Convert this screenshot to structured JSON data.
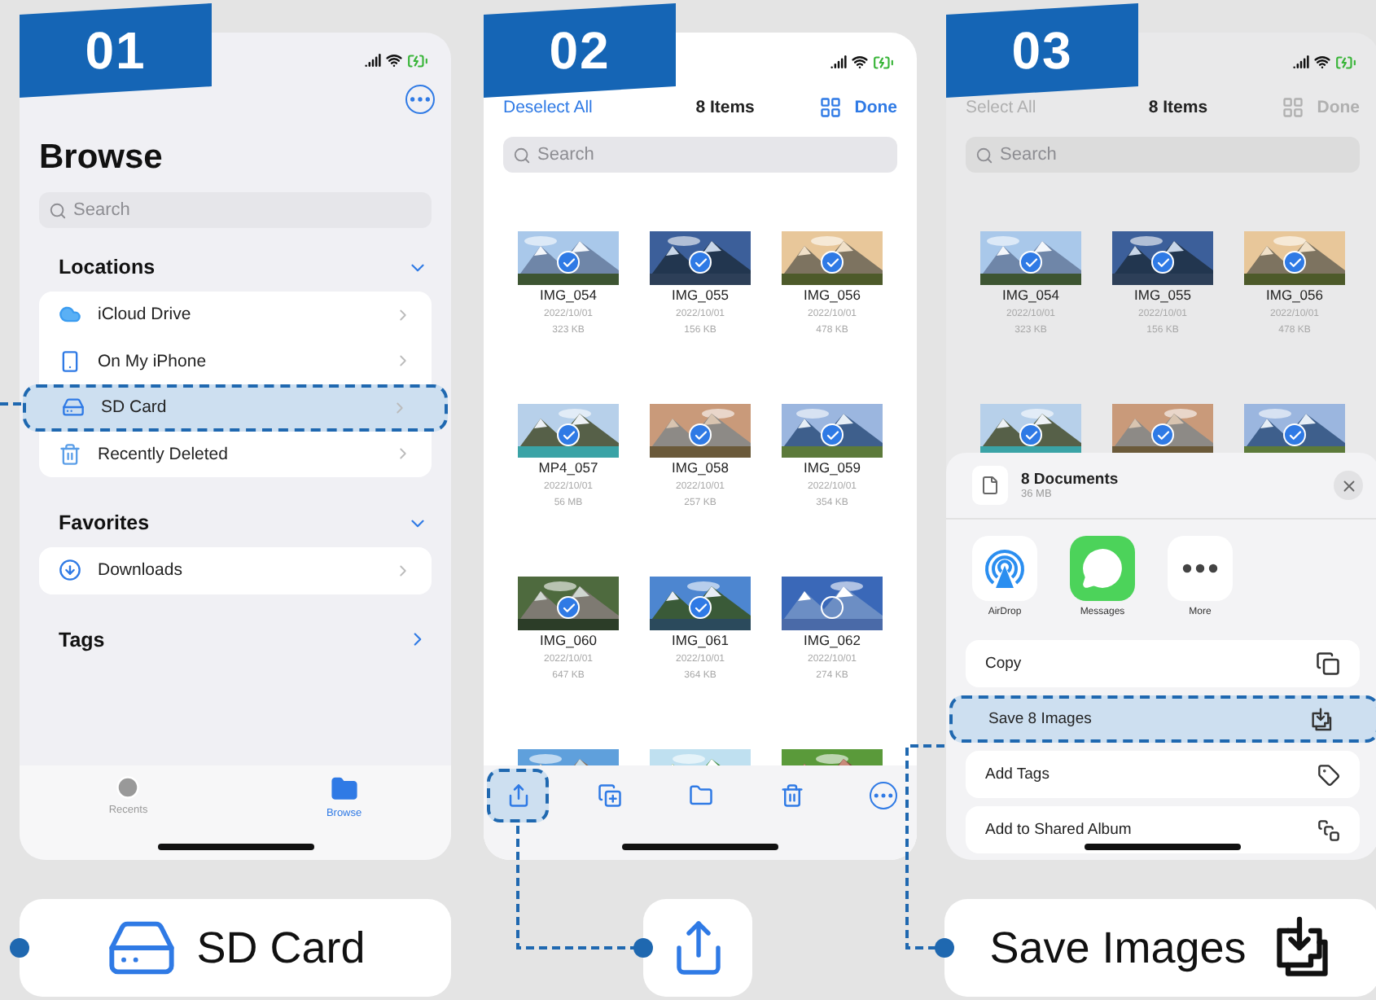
{
  "screen_1": {
    "badge": "01",
    "title": "Browse",
    "search": {
      "placeholder": "Search"
    },
    "sections": [
      {
        "title": "Locations",
        "expanded": true,
        "items": [
          {
            "label": "iCloud Drive",
            "kind": "cloud",
            "highlighted": false
          },
          {
            "label": "On My iPhone",
            "kind": "phone",
            "highlighted": false
          },
          {
            "label": "SD Card",
            "kind": "drive",
            "highlighted": true
          },
          {
            "label": "Recently Deleted",
            "kind": "trash",
            "highlighted": false
          }
        ]
      },
      {
        "title": "Favorites",
        "expanded": true,
        "items": [
          {
            "label": "Downloads",
            "kind": "download",
            "highlighted": false
          }
        ]
      },
      {
        "title": "Tags",
        "expanded": false
      }
    ],
    "tab_bar": [
      {
        "label": "Recents",
        "kind": "clock",
        "selected": false
      },
      {
        "label": "Browse",
        "kind": "folder",
        "selected": true
      }
    ]
  },
  "screen_2": {
    "badge": "02",
    "dimmed": false,
    "nav": {
      "left": "Deselect All",
      "title": "8 Items",
      "right": "Done"
    },
    "search": {
      "placeholder": "Search"
    },
    "files": [
      {
        "name": "IMG_054",
        "date": "2022/10/01",
        "size": "323  KB",
        "selected": true
      },
      {
        "name": "IMG_055",
        "date": "2022/10/01",
        "size": "156  KB",
        "selected": true
      },
      {
        "name": "IMG_056",
        "date": "2022/10/01",
        "size": "478  KB",
        "selected": true
      },
      {
        "name": "MP4_057",
        "date": "2022/10/01",
        "size": "56  MB",
        "selected": true
      },
      {
        "name": "IMG_058",
        "date": "2022/10/01",
        "size": "257  KB",
        "selected": true
      },
      {
        "name": "IMG_059",
        "date": "2022/10/01",
        "size": "354  KB",
        "selected": true
      },
      {
        "name": "IMG_060",
        "date": "2022/10/01",
        "size": "647  KB",
        "selected": true
      },
      {
        "name": "IMG_061",
        "date": "2022/10/01",
        "size": "364  KB",
        "selected": true
      },
      {
        "name": "IMG_062",
        "date": "2022/10/01",
        "size": "274  KB",
        "selected": false
      },
      {
        "kind": "picture"
      },
      {
        "kind": "picture"
      },
      {
        "kind": "picture"
      }
    ],
    "toolbar": [
      {
        "kind": "share",
        "highlighted": true
      },
      {
        "kind": "duplicate",
        "highlighted": false
      },
      {
        "kind": "folder",
        "highlighted": false
      },
      {
        "kind": "trash",
        "highlighted": false
      },
      {
        "kind": "more",
        "highlighted": false
      }
    ]
  },
  "screen_3": {
    "badge": "03",
    "dimmed": true,
    "nav": {
      "left": "Select All",
      "title": "8 Items",
      "right": "Done"
    },
    "search": {
      "placeholder": "Search"
    },
    "files": [
      {
        "name": "IMG_054",
        "date": "2022/10/01",
        "size": "323  KB",
        "selected": true
      },
      {
        "name": "IMG_055",
        "date": "2022/10/01",
        "size": "156  KB",
        "selected": true
      },
      {
        "name": "IMG_056",
        "date": "2022/10/01",
        "size": "478  KB",
        "selected": true
      },
      {
        "selected": true
      },
      {
        "selected": true
      },
      {
        "selected": true
      }
    ],
    "share_sheet": {
      "title": "8 Documents",
      "subtitle": "36 MB",
      "apps": [
        {
          "label": "AirDrop",
          "kind": "airdrop"
        },
        {
          "label": "Messages",
          "kind": "messages"
        },
        {
          "label": "More",
          "kind": "more"
        }
      ],
      "actions": [
        {
          "label": "Copy",
          "kind": "copy",
          "highlighted": false
        },
        {
          "label": "Save 8 Images",
          "kind": "save",
          "highlighted": true
        },
        {
          "label": "Add Tags",
          "kind": "tag",
          "highlighted": false
        },
        {
          "label": "Add to Shared Album",
          "kind": "album",
          "highlighted": false
        }
      ]
    }
  },
  "callouts": [
    {
      "kind": "drive",
      "label": "SD Card"
    },
    {
      "kind": "share"
    },
    {
      "kind": "save",
      "label": "Save Images"
    }
  ]
}
